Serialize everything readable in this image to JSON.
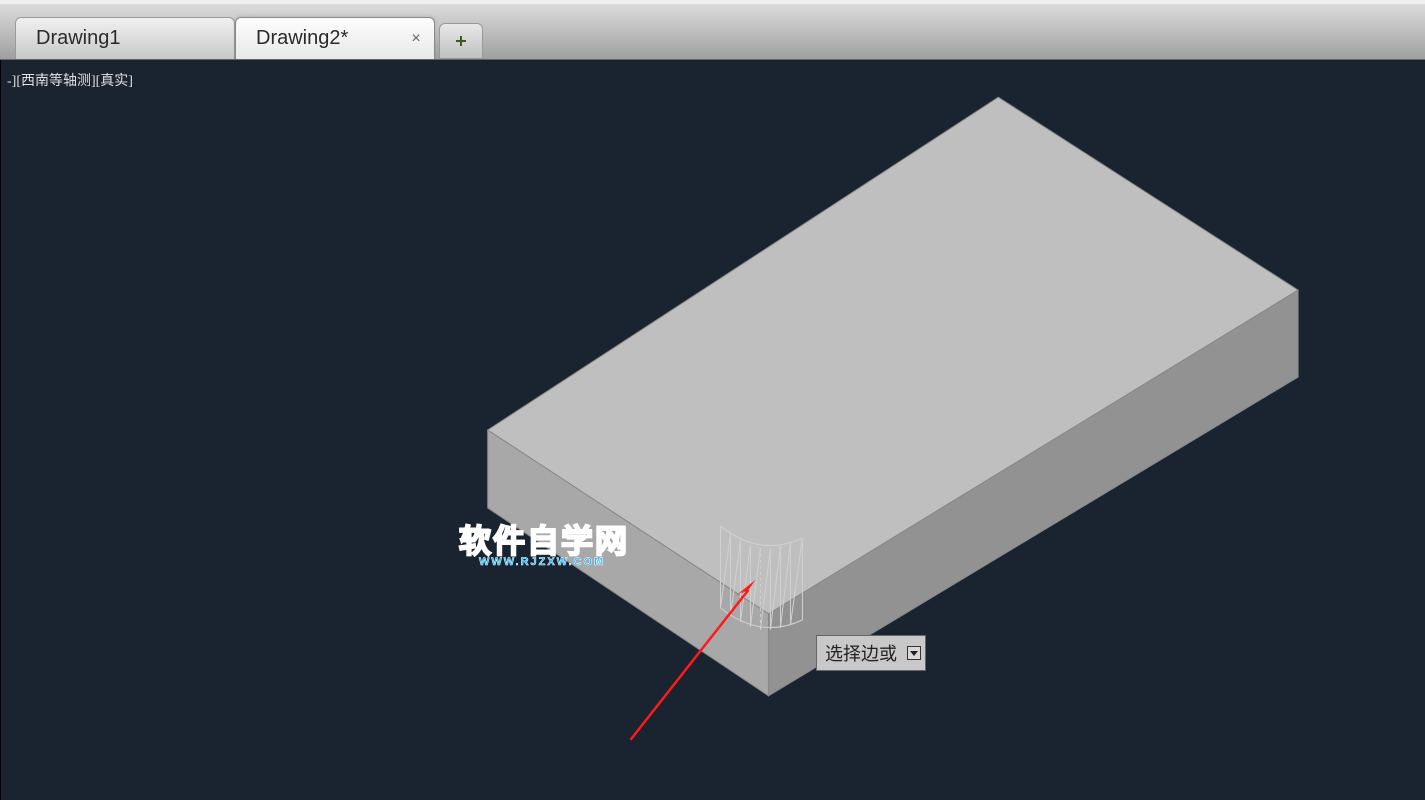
{
  "tabs": {
    "inactive_label": "Drawing1",
    "active_label": "Drawing2*"
  },
  "viewport": {
    "view_label": "-][西南等轴测][真实]"
  },
  "tooltip": {
    "text": "选择边或"
  },
  "watermark": {
    "main": "软件自学网",
    "sub": "WWW.RJZXW.COM"
  }
}
